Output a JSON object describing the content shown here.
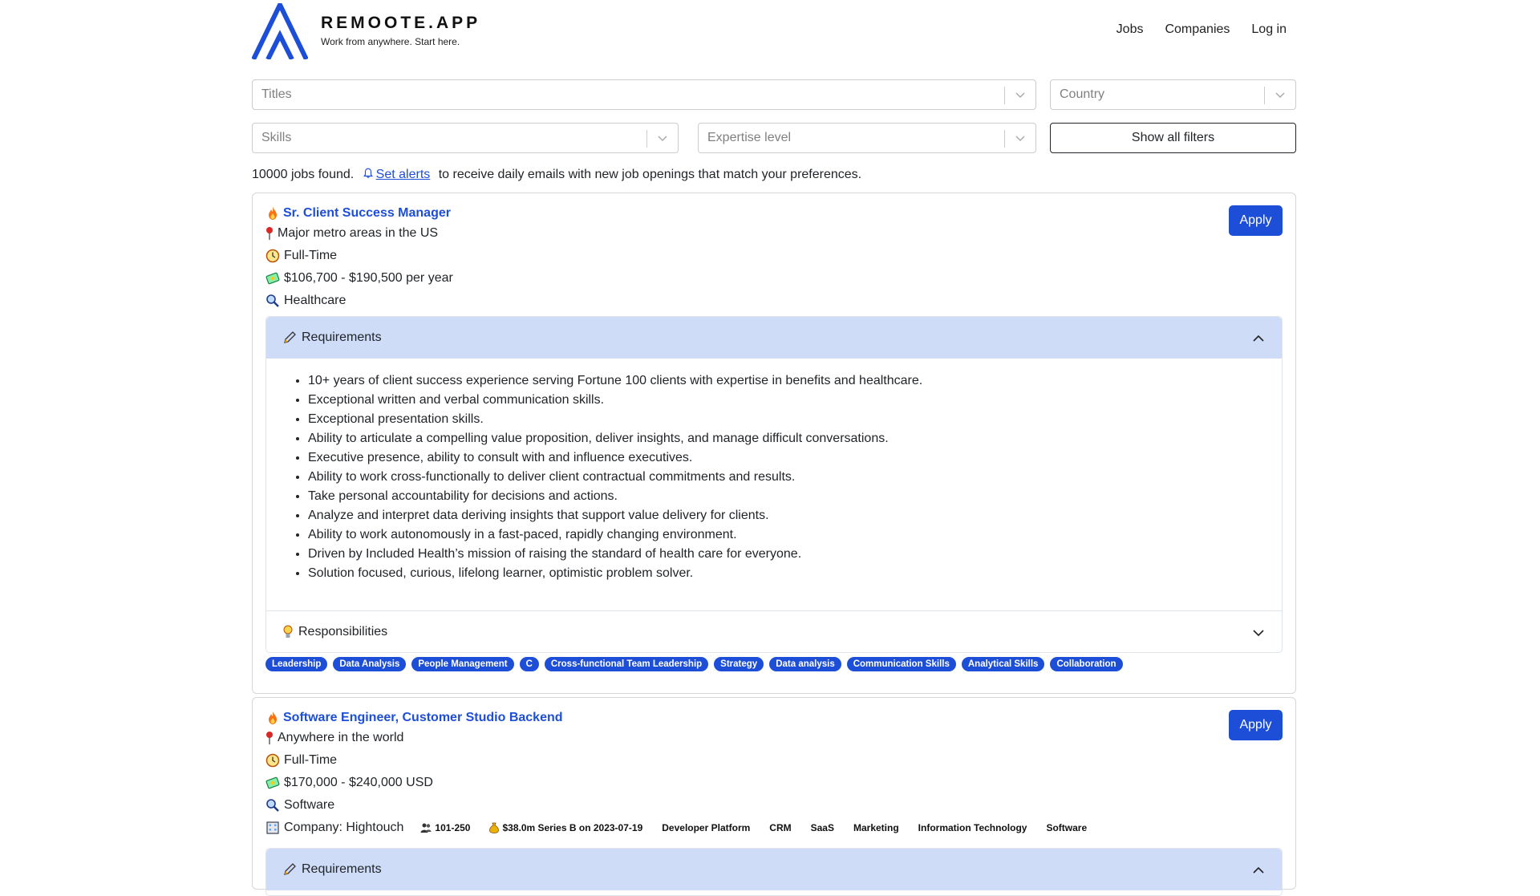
{
  "brand": {
    "name": "REMOOTE.APP",
    "tagline": "Work from anywhere. Start here.",
    "color": "#1d4ed8"
  },
  "nav": {
    "jobs": "Jobs",
    "companies": "Companies",
    "login": "Log in"
  },
  "filters": {
    "titles_placeholder": "Titles",
    "country_placeholder": "Country",
    "skills_placeholder": "Skills",
    "expertise_placeholder": "Expertise level",
    "show_all_label": "Show all filters"
  },
  "summary": {
    "count_text": "10000 jobs found.",
    "alert_link": "Set alerts",
    "alert_suffix": "to receive daily emails with new job openings that match your preferences."
  },
  "jobs": [
    {
      "title": "Sr. Client Success Manager",
      "location": "Major metro areas in the US",
      "type": "Full-Time",
      "salary": "$106,700 - $190,500 per year",
      "industry": "Healthcare",
      "apply_label": "Apply",
      "requirements_label": "Requirements",
      "requirements": [
        "10+ years of client success experience serving Fortune 100 clients with expertise in benefits and healthcare.",
        "Exceptional written and verbal communication skills.",
        "Exceptional presentation skills.",
        "Ability to articulate a compelling value proposition, deliver insights, and manage difficult conversations.",
        "Executive presence, ability to consult with and influence executives.",
        "Ability to work cross-functionally to deliver client contractual commitments and results.",
        "Take personal accountability for decisions and actions.",
        "Analyze and interpret data deriving insights that support value delivery for clients.",
        "Ability to work autonomously in a fast-paced, rapidly changing environment.",
        "Driven by Included Health’s mission of raising the standard of health care for everyone.",
        "Solution focused, curious, lifelong learner, optimistic problem solver."
      ],
      "responsibilities_label": "Responsibilities",
      "tags": [
        "Leadership",
        "Data Analysis",
        "People Management",
        "C",
        "Cross-functional Team Leadership",
        "Strategy",
        "Data analysis",
        "Communication Skills",
        "Analytical Skills",
        "Collaboration"
      ]
    },
    {
      "title": "Software Engineer, Customer Studio Backend",
      "location": "Anywhere in the world",
      "type": "Full-Time",
      "salary": "$170,000 - $240,000 USD",
      "industry": "Software",
      "company": "Company: Hightouch",
      "company_size": "101-250",
      "funding": "$38.0m Series B on 2023-07-19",
      "company_tags": [
        "Developer Platform",
        "CRM",
        "SaaS",
        "Marketing",
        "Information Technology",
        "Software"
      ],
      "apply_label": "Apply",
      "requirements_label": "Requirements"
    }
  ]
}
